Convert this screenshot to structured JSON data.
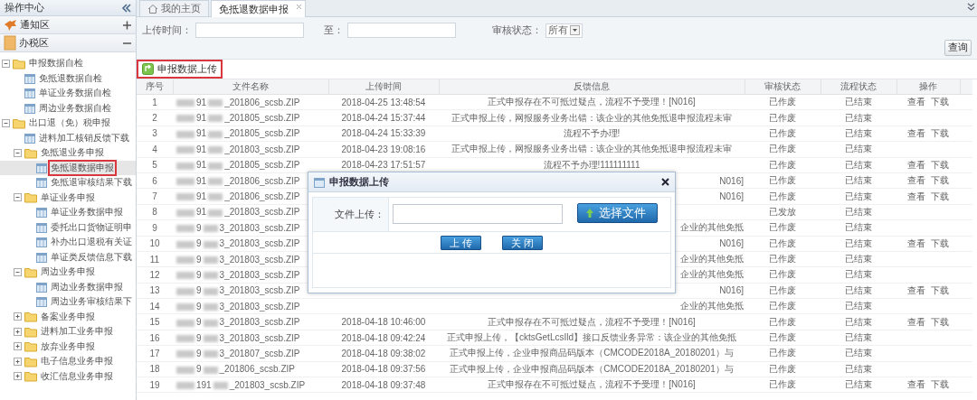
{
  "sidebar": {
    "title": "操作中心",
    "sections": [
      {
        "label": "通知区",
        "expanded": false,
        "kind": "notice"
      },
      {
        "label": "办税区",
        "expanded": true,
        "kind": "tax"
      }
    ],
    "tree": [
      {
        "label": "申报数据自检",
        "kind": "folder",
        "expanded": true,
        "children": [
          {
            "label": "免抵退数据自检",
            "kind": "page",
            "selected": false
          },
          {
            "label": "单证业务数据自检",
            "kind": "page",
            "selected": false
          },
          {
            "label": "周边业务数据自检",
            "kind": "page",
            "selected": false
          }
        ]
      },
      {
        "label": "出口退（免）税申报",
        "kind": "folder",
        "expanded": true,
        "children": [
          {
            "label": "进料加工核销反馈下载",
            "kind": "page",
            "selected": false
          },
          {
            "label": "免抵退业务申报",
            "kind": "folder",
            "expanded": true,
            "children": [
              {
                "label": "免抵退数据申报",
                "kind": "page",
                "selected": true
              },
              {
                "label": "免抵退审核结果下载",
                "kind": "page",
                "selected": false
              }
            ]
          },
          {
            "label": "单证业务申报",
            "kind": "folder",
            "expanded": true,
            "children": [
              {
                "label": "单证业务数据申报",
                "kind": "page",
                "selected": false
              },
              {
                "label": "委托出口货物证明申",
                "kind": "page",
                "selected": false
              },
              {
                "label": "补办出口退税有关证",
                "kind": "page",
                "selected": false
              },
              {
                "label": "单证类反馈信息下载",
                "kind": "page",
                "selected": false
              }
            ]
          },
          {
            "label": "周边业务申报",
            "kind": "folder",
            "expanded": true,
            "children": [
              {
                "label": "周边业务数据申报",
                "kind": "page",
                "selected": false
              },
              {
                "label": "周边业务审核结果下",
                "kind": "page",
                "selected": false
              }
            ]
          },
          {
            "label": "备案业务申报",
            "kind": "folder",
            "expanded": false
          },
          {
            "label": "进料加工业务申报",
            "kind": "folder",
            "expanded": false
          },
          {
            "label": "放弃业务申报",
            "kind": "folder",
            "expanded": false
          },
          {
            "label": "电子信息业务申报",
            "kind": "folder",
            "expanded": false
          },
          {
            "label": "收汇信息业务申报",
            "kind": "folder",
            "expanded": false
          }
        ]
      }
    ]
  },
  "tabs": [
    {
      "label": "我的主页",
      "selected": false,
      "closable": false,
      "kind": "home"
    },
    {
      "label": "免抵退数据申报",
      "selected": true,
      "closable": true,
      "kind": "page"
    }
  ],
  "filters": {
    "time_label": "上传时间：",
    "to_label": "至：",
    "status_label": "审核状态：",
    "status_value": "所有"
  },
  "query_button": "查询",
  "toolbar": {
    "label": "申报数据上传",
    "highlighted": true
  },
  "table": {
    "columns": [
      "序号",
      "文件名称",
      "上传时间",
      "反馈信息",
      "审核状态",
      "流程状态",
      "操作"
    ],
    "rows": [
      {
        "no": "1",
        "file_name": [
          "91",
          "_201806_scsb.ZIP"
        ],
        "upload_time": "2018-04-25 13:48:54",
        "feedback": "正式申报存在不可抵过疑点，流程不予受理！[N016]",
        "review_status": "已作废",
        "process_status": "已结束",
        "actions": [
          "查看",
          "下载"
        ]
      },
      {
        "no": "2",
        "file_name": [
          "91",
          "_201805_scsb.ZIP"
        ],
        "upload_time": "2018-04-24 15:37:44",
        "feedback": "正式申报上传，网报服务业务出错：该企业的其他免抵退申报流程未审",
        "review_status": "已作废",
        "process_status": "已结束",
        "actions": []
      },
      {
        "no": "3",
        "file_name": [
          "91",
          "_201805_scsb.ZIP"
        ],
        "upload_time": "2018-04-24 15:33:39",
        "feedback": "流程不予办理!",
        "review_status": "已作废",
        "process_status": "已结束",
        "actions": [
          "查看",
          "下载"
        ]
      },
      {
        "no": "4",
        "file_name": [
          "91",
          "_201803_scsb.ZIP"
        ],
        "upload_time": "2018-04-23 19:08:16",
        "feedback": "正式申报上传，网报服务业务出错：该企业的其他免抵退申报流程未审",
        "review_status": "已作废",
        "process_status": "已结束",
        "actions": []
      },
      {
        "no": "5",
        "file_name": [
          "91",
          "_201805_scsb.ZIP"
        ],
        "upload_time": "2018-04-23 17:51:57",
        "feedback": "流程不予办理!111111111",
        "review_status": "已作废",
        "process_status": "已结束",
        "actions": [
          "查看",
          "下载"
        ]
      },
      {
        "no": "6",
        "file_name": [
          "91",
          "_201806_scsb.ZIP"
        ],
        "feedback": "N016]",
        "review_status": "已作废",
        "process_status": "已结束",
        "actions": [
          "查看",
          "下载"
        ]
      },
      {
        "no": "7",
        "file_name": [
          "91",
          "_201806_scsb.ZIP"
        ],
        "feedback": "N016]",
        "review_status": "已作废",
        "process_status": "已结束",
        "actions": [
          "查看",
          "下载"
        ]
      },
      {
        "no": "8",
        "file_name": [
          "91",
          "_201803_scsb.ZIP"
        ],
        "review_status": "已发放",
        "process_status": "已结束",
        "actions": []
      },
      {
        "no": "9",
        "file_name": [
          "9",
          "3_201803_scsb.ZIP"
        ],
        "feedback": "企业的其他免抵",
        "review_status": "已作废",
        "process_status": "已结束",
        "actions": []
      },
      {
        "no": "10",
        "file_name": [
          "9",
          "3_201803_scsb.ZIP"
        ],
        "feedback": "N016]",
        "review_status": "已作废",
        "process_status": "已结束",
        "actions": [
          "查看",
          "下载"
        ]
      },
      {
        "no": "11",
        "file_name": [
          "9",
          "3_201803_scsb.ZIP"
        ],
        "feedback": "企业的其他免抵",
        "review_status": "已作废",
        "process_status": "已结束",
        "actions": []
      },
      {
        "no": "12",
        "file_name": [
          "9",
          "3_201803_scsb.ZIP"
        ],
        "feedback": "企业的其他免抵",
        "review_status": "已作废",
        "process_status": "已结束",
        "actions": []
      },
      {
        "no": "13",
        "file_name": [
          "9",
          "3_201803_scsb.ZIP"
        ],
        "feedback": "N016]",
        "review_status": "已作废",
        "process_status": "已结束",
        "actions": [
          "查看",
          "下载"
        ]
      },
      {
        "no": "14",
        "file_name": [
          "9",
          "3_201803_scsb.ZIP"
        ],
        "feedback": "企业的其他免抵",
        "review_status": "已作废",
        "process_status": "已结束",
        "actions": []
      },
      {
        "no": "15",
        "file_name": [
          "9",
          "3_201803_scsb.ZIP"
        ],
        "upload_time": "2018-04-18 10:46:00",
        "feedback": "正式申报存在不可抵过疑点，流程不予受理！[N016]",
        "review_status": "已作废",
        "process_status": "已结束",
        "actions": [
          "查看",
          "下载"
        ]
      },
      {
        "no": "16",
        "file_name": [
          "9",
          "3_201803_scsb.ZIP"
        ],
        "upload_time": "2018-04-18 09:42:24",
        "feedback": "正式申报上传，【cktsGetLcsIld】接口反馈业务异常：该企业的其他免抵",
        "review_status": "已作废",
        "process_status": "已结束",
        "actions": []
      },
      {
        "no": "17",
        "file_name": [
          "9",
          "3_201807_scsb.ZIP"
        ],
        "upload_time": "2018-04-18 09:38:02",
        "feedback": "正式申报上传，企业申报商品码版本（CMCODE2018A_20180201）与",
        "review_status": "已作废",
        "process_status": "已结束",
        "actions": []
      },
      {
        "no": "18",
        "file_name": [
          "9",
          "_201806_scsb.ZIP"
        ],
        "upload_time": "2018-04-18 09:37:56",
        "feedback": "正式申报上传，企业申报商品码版本（CMCODE2018A_20180201）与",
        "review_status": "已作废",
        "process_status": "已结束",
        "actions": []
      },
      {
        "no": "19",
        "file_name": [
          "191",
          "_201803_scsb.ZIP"
        ],
        "upload_time": "2018-04-18 09:37:48",
        "feedback": "正式申报存在不可抵过疑点，流程不予受理！[N016]",
        "review_status": "已作废",
        "process_status": "已结束",
        "actions": [
          "查看",
          "下载"
        ]
      }
    ]
  },
  "dialog": {
    "title": "申报数据上传",
    "field_label": "文件上传：",
    "choose_button": "选择文件",
    "buttons": [
      "上 传",
      "关 闭"
    ]
  }
}
